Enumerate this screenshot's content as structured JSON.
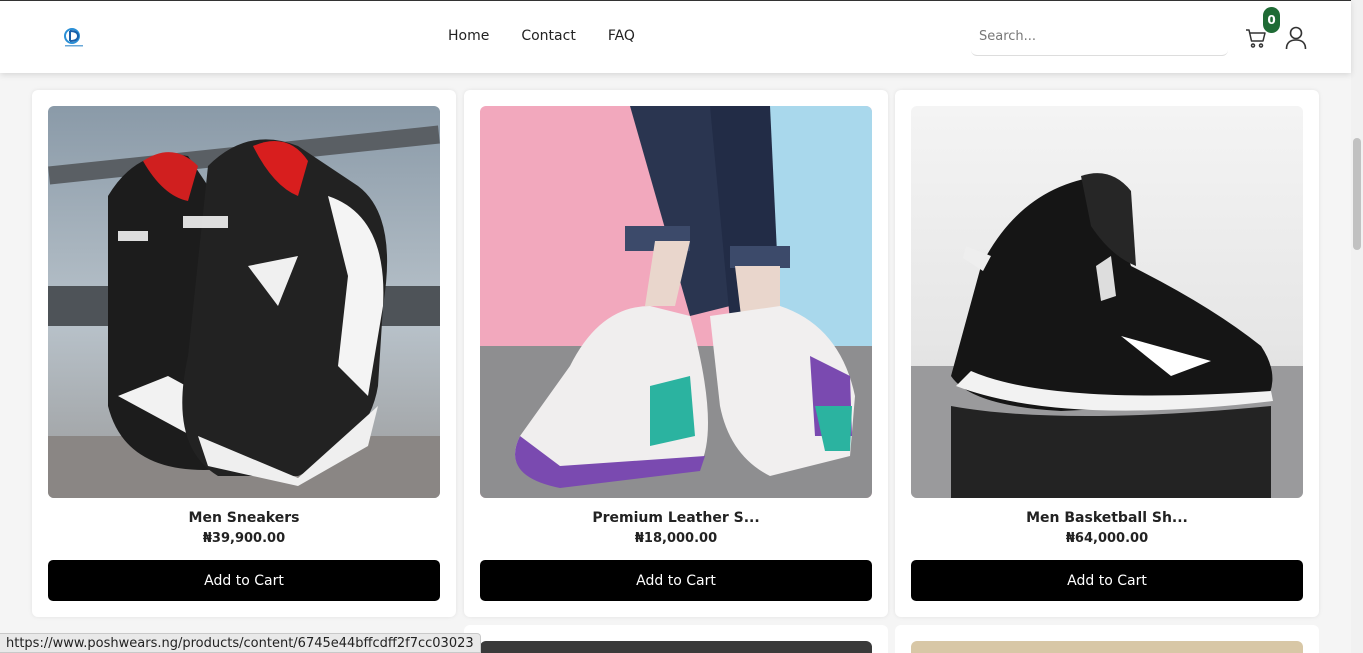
{
  "header": {
    "nav": [
      "Home",
      "Contact",
      "FAQ"
    ],
    "search_placeholder": "Search...",
    "cart_count": "0"
  },
  "products": [
    {
      "name": "Men Sneakers",
      "price": "₦39,900.00",
      "button": "Add to Cart"
    },
    {
      "name": "Premium Leather S...",
      "price": "₦18,000.00",
      "button": "Add to Cart"
    },
    {
      "name": "Men Basketball Sh...",
      "price": "₦64,000.00",
      "button": "Add to Cart"
    }
  ],
  "statusbar": {
    "url": "https://www.poshwears.ng/products/content/6745e44bffcdff2f7cc03023"
  },
  "icons": [
    "logo",
    "cart-icon",
    "user-icon"
  ],
  "colors": {
    "badge": "#1f6b35",
    "button": "#000000"
  }
}
